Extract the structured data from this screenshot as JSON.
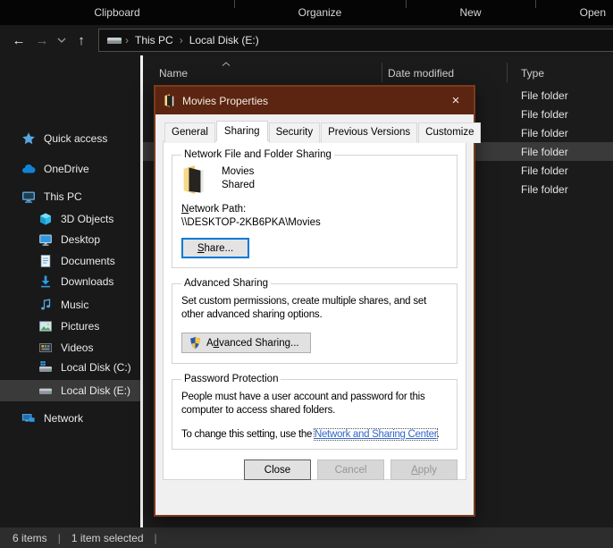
{
  "ribbon": {
    "groups": [
      {
        "label": "Clipboard"
      },
      {
        "label": "Organize"
      },
      {
        "label": "New"
      },
      {
        "label": "Open"
      }
    ]
  },
  "nav": {
    "breadcrumb": {
      "segments": [
        "This PC",
        "Local Disk (E:)"
      ]
    }
  },
  "sidebar": {
    "items": [
      {
        "label": "Quick access",
        "icon": "quick-access",
        "indent": 0,
        "selected": false
      },
      {
        "label": "OneDrive",
        "icon": "onedrive",
        "indent": 0,
        "selected": false
      },
      {
        "label": "This PC",
        "icon": "this-pc",
        "indent": 0,
        "selected": false
      },
      {
        "label": "3D Objects",
        "icon": "objects3d",
        "indent": 1,
        "selected": false
      },
      {
        "label": "Desktop",
        "icon": "desktop",
        "indent": 1,
        "selected": false
      },
      {
        "label": "Documents",
        "icon": "documents",
        "indent": 1,
        "selected": false
      },
      {
        "label": "Downloads",
        "icon": "downloads",
        "indent": 1,
        "selected": false
      },
      {
        "label": "Music",
        "icon": "music",
        "indent": 1,
        "selected": false
      },
      {
        "label": "Pictures",
        "icon": "pictures",
        "indent": 1,
        "selected": false
      },
      {
        "label": "Videos",
        "icon": "videos",
        "indent": 1,
        "selected": false
      },
      {
        "label": "Local Disk (C:)",
        "icon": "disk-os",
        "indent": 1,
        "selected": false
      },
      {
        "label": "Local Disk (E:)",
        "icon": "disk",
        "indent": 1,
        "selected": true
      },
      {
        "label": "Network",
        "icon": "network",
        "indent": 0,
        "selected": false
      }
    ]
  },
  "file_list": {
    "columns": [
      "Name",
      "Date modified",
      "Type"
    ],
    "rows": [
      {
        "type": "File folder",
        "selected": false
      },
      {
        "type": "File folder",
        "selected": false
      },
      {
        "type": "File folder",
        "selected": false
      },
      {
        "type": "File folder",
        "selected": true
      },
      {
        "type": "File folder",
        "selected": false
      },
      {
        "type": "File folder",
        "selected": false
      }
    ]
  },
  "dialog": {
    "title": "Movies Properties",
    "tabs": [
      {
        "label": "General",
        "active": false
      },
      {
        "label": "Sharing",
        "active": true
      },
      {
        "label": "Security",
        "active": false
      },
      {
        "label": "Previous Versions",
        "active": false
      },
      {
        "label": "Customize",
        "active": false
      }
    ],
    "sharing_tab": {
      "network_sharing": {
        "legend": "Network File and Folder Sharing",
        "folder_name": "Movies",
        "folder_status": "Shared",
        "network_path_label": {
          "text": "Network Path:",
          "accel": 0
        },
        "network_path": "\\\\DESKTOP-2KB6PKA\\Movies",
        "share_button": {
          "text": "Share...",
          "accel": 0
        }
      },
      "advanced_sharing": {
        "legend": "Advanced Sharing",
        "description": "Set custom permissions, create multiple shares, and set other advanced sharing options.",
        "button": {
          "text": "Advanced Sharing...",
          "accel": 1
        }
      },
      "password_protection": {
        "legend": "Password Protection",
        "description": "People must have a user account and password for this computer to access shared folders.",
        "change_prefix": "To change this setting, use the ",
        "link": "Network and Sharing Center",
        "change_suffix": "."
      }
    },
    "buttons": {
      "close": "Close",
      "cancel": "Cancel",
      "apply": {
        "text": "Apply",
        "accel": 0
      }
    }
  },
  "status_bar": {
    "items_count": "6 items",
    "selected_count": "1 item selected"
  }
}
